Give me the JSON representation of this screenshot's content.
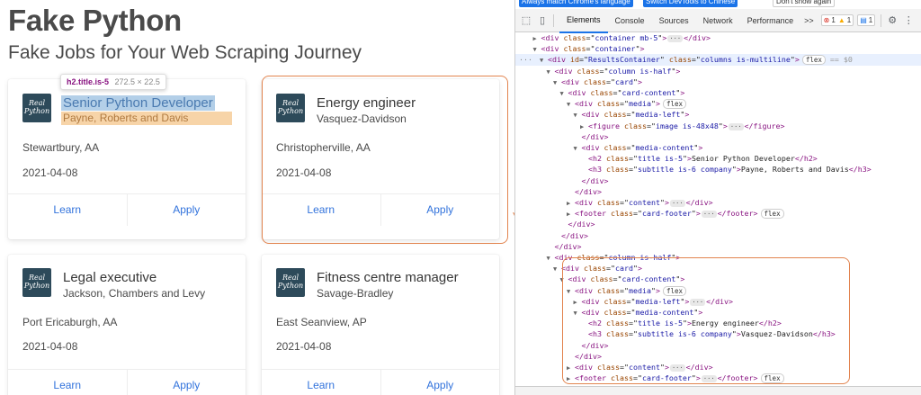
{
  "page": {
    "title": "Fake Python",
    "subtitle": "Fake Jobs for Your Web Scraping Journey",
    "logo_text": "Real\nPython",
    "cards": [
      {
        "title": "Senior Python Developer",
        "company": "Payne, Roberts and Davis",
        "location": "Stewartbury, AA",
        "date": "2021-04-08",
        "learn": "Learn",
        "apply": "Apply"
      },
      {
        "title": "Energy engineer",
        "company": "Vasquez-Davidson",
        "location": "Christopherville, AA",
        "date": "2021-04-08",
        "learn": "Learn",
        "apply": "Apply"
      },
      {
        "title": "Legal executive",
        "company": "Jackson, Chambers and Levy",
        "location": "Port Ericaburgh, AA",
        "date": "2021-04-08",
        "learn": "Learn",
        "apply": "Apply"
      },
      {
        "title": "Fitness centre manager",
        "company": "Savage-Bradley",
        "location": "East Seanview, AP",
        "date": "2021-04-08",
        "learn": "Learn",
        "apply": "Apply"
      }
    ],
    "tooltip": {
      "selector": "h2.title.is-5",
      "size": "272.5 × 22.5"
    }
  },
  "devtools": {
    "banner": {
      "btn1": "Always match Chrome's language",
      "btn2": "Switch DevTools to Chinese",
      "dismiss": "Don't show again"
    },
    "tabs": [
      "Elements",
      "Console",
      "Sources",
      "Network",
      "Performance"
    ],
    "more": ">>",
    "errors": "1",
    "warnings": "1",
    "messages": "1",
    "colors": {
      "accent": "#1a73e8",
      "tag": "#881280",
      "attr_name": "#994500",
      "attr_value": "#1a1aa6",
      "annotation": "#e2844f"
    },
    "lines": [
      {
        "indent": 1,
        "tri": "▶",
        "html": "<span class='tg'>&lt;div</span> <span class='an'>class</span>=\"<span class='av'>container mb-5</span>\"<span class='tg'>&gt;</span><span class='ell'>···</span><span class='tg'>&lt;/div&gt;</span>"
      },
      {
        "indent": 1,
        "tri": "▼",
        "html": "<span class='tg'>&lt;div</span> <span class='an'>class</span>=\"<span class='av'>container</span>\"<span class='tg'>&gt;</span>"
      },
      {
        "indent": 2,
        "tri": "▼",
        "sel": true,
        "html": "<span class='tg'>&lt;div</span> <span class='an'>id</span>=\"<span class='av'>ResultsContainer</span>\" <span class='an'>class</span>=\"<span class='av'>columns is-multiline</span>\"<span class='tg'>&gt;</span><span class='pill'>flex</span> <span class='dim'>== $0</span>"
      },
      {
        "indent": 3,
        "tri": "▼",
        "html": "<span class='tg'>&lt;div</span> <span class='an'>class</span>=\"<span class='av'>column is-half</span>\"<span class='tg'>&gt;</span>"
      },
      {
        "indent": 4,
        "tri": "▼",
        "html": "<span class='tg'>&lt;div</span> <span class='an'>class</span>=\"<span class='av'>card</span>\"<span class='tg'>&gt;</span>"
      },
      {
        "indent": 5,
        "tri": "▼",
        "html": "<span class='tg'>&lt;div</span> <span class='an'>class</span>=\"<span class='av'>card-content</span>\"<span class='tg'>&gt;</span>"
      },
      {
        "indent": 6,
        "tri": "▼",
        "html": "<span class='tg'>&lt;div</span> <span class='an'>class</span>=\"<span class='av'>media</span>\"<span class='tg'>&gt;</span><span class='pill'>flex</span>"
      },
      {
        "indent": 7,
        "tri": "▼",
        "html": "<span class='tg'>&lt;div</span> <span class='an'>class</span>=\"<span class='av'>media-left</span>\"<span class='tg'>&gt;</span>"
      },
      {
        "indent": 8,
        "tri": "▶",
        "html": "<span class='tg'>&lt;figure</span> <span class='an'>class</span>=\"<span class='av'>image is-48x48</span>\"<span class='tg'>&gt;</span><span class='ell'>···</span><span class='tg'>&lt;/figure&gt;</span>"
      },
      {
        "indent": 7,
        "tri": "",
        "html": "<span class='tg'>&lt;/div&gt;</span>"
      },
      {
        "indent": 7,
        "tri": "▼",
        "html": "<span class='tg'>&lt;div</span> <span class='an'>class</span>=\"<span class='av'>media-content</span>\"<span class='tg'>&gt;</span>"
      },
      {
        "indent": 8,
        "tri": "",
        "html": "<span class='tg'>&lt;h2</span> <span class='an'>class</span>=\"<span class='av'>title is-5</span>\"<span class='tg'>&gt;</span><span class='tx'>Senior Python Developer</span><span class='tg'>&lt;/h2&gt;</span>"
      },
      {
        "indent": 8,
        "tri": "",
        "html": "<span class='tg'>&lt;h3</span> <span class='an'>class</span>=\"<span class='av'>subtitle is-6 company</span>\"<span class='tg'>&gt;</span><span class='tx'>Payne, Roberts and Davis</span><span class='tg'>&lt;/h3&gt;</span>"
      },
      {
        "indent": 7,
        "tri": "",
        "html": "<span class='tg'>&lt;/div&gt;</span>"
      },
      {
        "indent": 6,
        "tri": "",
        "html": "<span class='tg'>&lt;/div&gt;</span>"
      },
      {
        "indent": 6,
        "tri": "▶",
        "html": "<span class='tg'>&lt;div</span> <span class='an'>class</span>=\"<span class='av'>content</span>\"<span class='tg'>&gt;</span><span class='ell'>···</span><span class='tg'>&lt;/div&gt;</span>"
      },
      {
        "indent": 6,
        "tri": "▶",
        "html": "<span class='tg'>&lt;footer</span> <span class='an'>class</span>=\"<span class='av'>card-footer</span>\"<span class='tg'>&gt;</span><span class='ell'>···</span><span class='tg'>&lt;/footer&gt;</span><span class='pill'>flex</span>"
      },
      {
        "indent": 5,
        "tri": "",
        "html": "<span class='tg'>&lt;/div&gt;</span>"
      },
      {
        "indent": 4,
        "tri": "",
        "html": "<span class='tg'>&lt;/div&gt;</span>"
      },
      {
        "indent": 3,
        "tri": "",
        "html": "<span class='tg'>&lt;/div&gt;</span>"
      },
      {
        "indent": 3,
        "tri": "▼",
        "html": "<span class='tg'>&lt;div</span> <span class='an'>class</span>=\"<span class='av'>column is-half</span>\"<span class='tg'>&gt;</span>"
      },
      {
        "indent": 4,
        "tri": "▼",
        "html": "<span class='tg'>&lt;div</span> <span class='an'>class</span>=\"<span class='av'>card</span>\"<span class='tg'>&gt;</span>"
      },
      {
        "indent": 5,
        "tri": "▼",
        "html": "<span class='tg'>&lt;div</span> <span class='an'>class</span>=\"<span class='av'>card-content</span>\"<span class='tg'>&gt;</span>"
      },
      {
        "indent": 6,
        "tri": "▼",
        "html": "<span class='tg'>&lt;div</span> <span class='an'>class</span>=\"<span class='av'>media</span>\"<span class='tg'>&gt;</span><span class='pill'>flex</span>"
      },
      {
        "indent": 7,
        "tri": "▶",
        "html": "<span class='tg'>&lt;div</span> <span class='an'>class</span>=\"<span class='av'>media-left</span>\"<span class='tg'>&gt;</span><span class='ell'>···</span><span class='tg'>&lt;/div&gt;</span>"
      },
      {
        "indent": 7,
        "tri": "▼",
        "html": "<span class='tg'>&lt;div</span> <span class='an'>class</span>=\"<span class='av'>media-content</span>\"<span class='tg'>&gt;</span>"
      },
      {
        "indent": 8,
        "tri": "",
        "html": "<span class='tg'>&lt;h2</span> <span class='an'>class</span>=\"<span class='av'>title is-5</span>\"<span class='tg'>&gt;</span><span class='tx'>Energy engineer</span><span class='tg'>&lt;/h2&gt;</span>"
      },
      {
        "indent": 8,
        "tri": "",
        "html": "<span class='tg'>&lt;h3</span> <span class='an'>class</span>=\"<span class='av'>subtitle is-6 company</span>\"<span class='tg'>&gt;</span><span class='tx'>Vasquez-Davidson</span><span class='tg'>&lt;/h3&gt;</span>"
      },
      {
        "indent": 7,
        "tri": "",
        "html": "<span class='tg'>&lt;/div&gt;</span>"
      },
      {
        "indent": 6,
        "tri": "",
        "html": "<span class='tg'>&lt;/div&gt;</span>"
      },
      {
        "indent": 6,
        "tri": "▶",
        "html": "<span class='tg'>&lt;div</span> <span class='an'>class</span>=\"<span class='av'>content</span>\"<span class='tg'>&gt;</span><span class='ell'>···</span><span class='tg'>&lt;/div&gt;</span>"
      },
      {
        "indent": 6,
        "tri": "▶",
        "html": "<span class='tg'>&lt;footer</span> <span class='an'>class</span>=\"<span class='av'>card-footer</span>\"<span class='tg'>&gt;</span><span class='ell'>···</span><span class='tg'>&lt;/footer&gt;</span><span class='pill'>flex</span>"
      }
    ]
  }
}
